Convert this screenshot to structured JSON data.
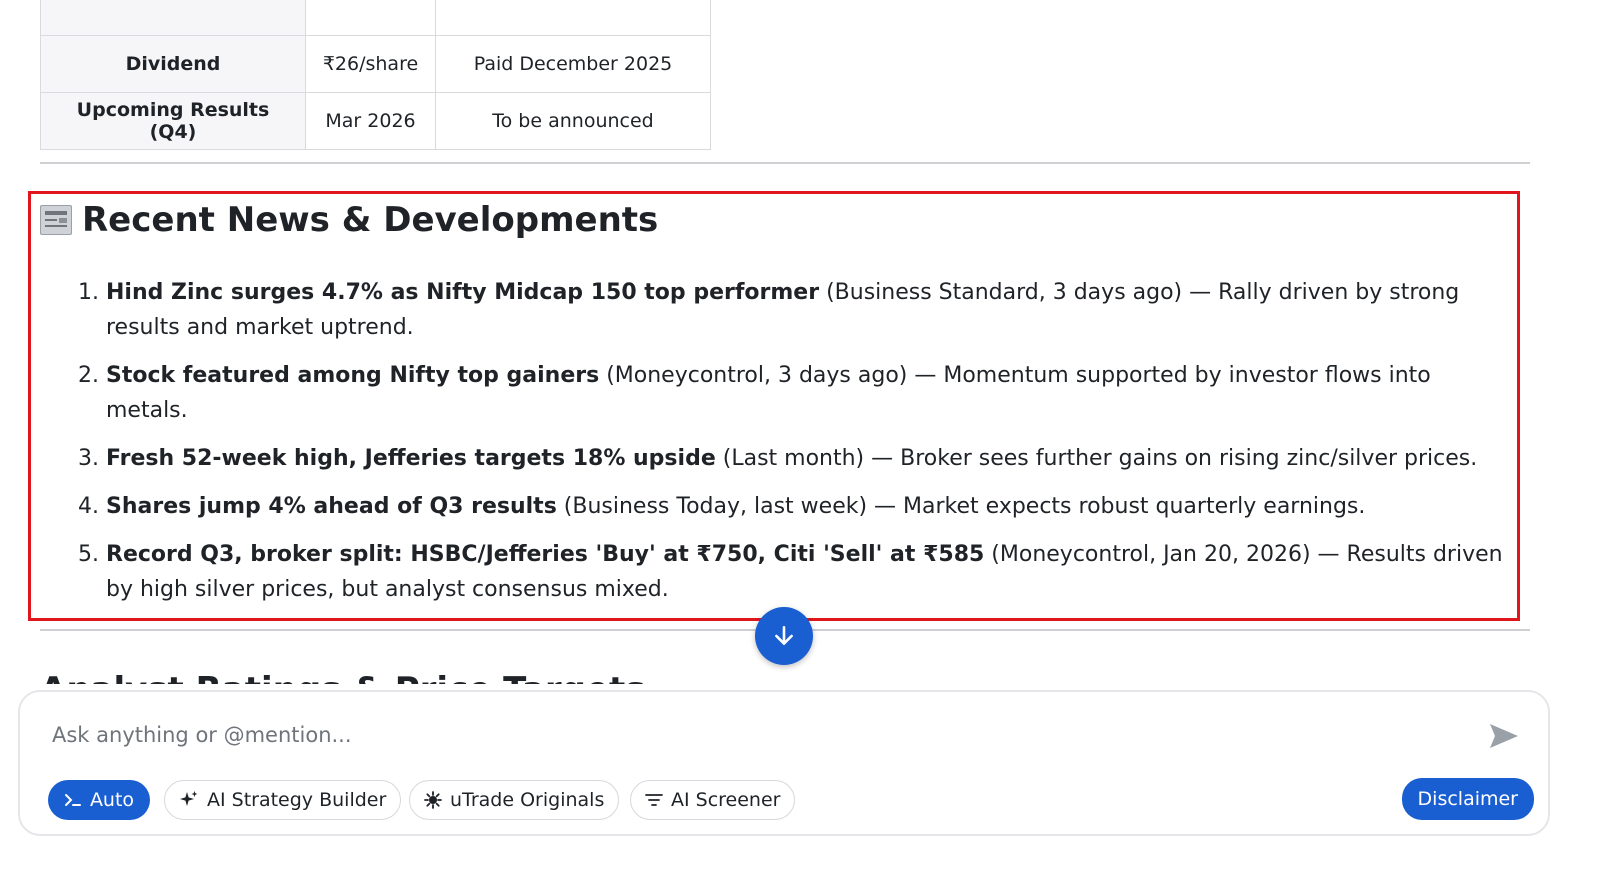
{
  "table": {
    "rows": [
      {
        "label": "Dividend",
        "value": "₹26/share",
        "note": "Paid December 2025"
      },
      {
        "label": "Upcoming Results (Q4)",
        "value": "Mar 2026",
        "note": "To be announced"
      }
    ]
  },
  "news": {
    "title": "Recent News & Developments",
    "icon": "newspaper-icon",
    "items": [
      {
        "headline": "Hind Zinc surges 4.7% as Nifty Midcap 150 top performer",
        "source": " (Business Standard, 3 days ago)",
        "summary": " — Rally driven by strong results and market uptrend."
      },
      {
        "headline": "Stock featured among Nifty top gainers",
        "source": " (Moneycontrol, 3 days ago)",
        "summary": " — Momentum supported by investor flows into metals."
      },
      {
        "headline": "Fresh 52-week high, Jefferies targets 18% upside",
        "source": " (Last month)",
        "summary": " — Broker sees further gains on rising zinc/silver prices."
      },
      {
        "headline": "Shares jump 4% ahead of Q3 results",
        "source": " (Business Today, last week)",
        "summary": " — Market expects robust quarterly earnings."
      },
      {
        "headline": "Record Q3, broker split: HSBC/Jefferies 'Buy' at ₹750, Citi 'Sell' at ₹585",
        "source": " (Moneycontrol, Jan 20, 2026)",
        "summary": " — Results driven by high silver prices, but analyst consensus mixed."
      }
    ]
  },
  "next_section": {
    "title": "Analyst Ratings & Price Targets"
  },
  "composer": {
    "placeholder": "Ask anything or @mention...",
    "buttons": {
      "auto": "Auto",
      "strategy": "AI Strategy Builder",
      "originals": "uTrade Originals",
      "screener": "AI Screener",
      "disclaimer": "Disclaimer"
    }
  },
  "colors": {
    "accent": "#1a5fd1",
    "highlight_border": "#e0161d"
  }
}
